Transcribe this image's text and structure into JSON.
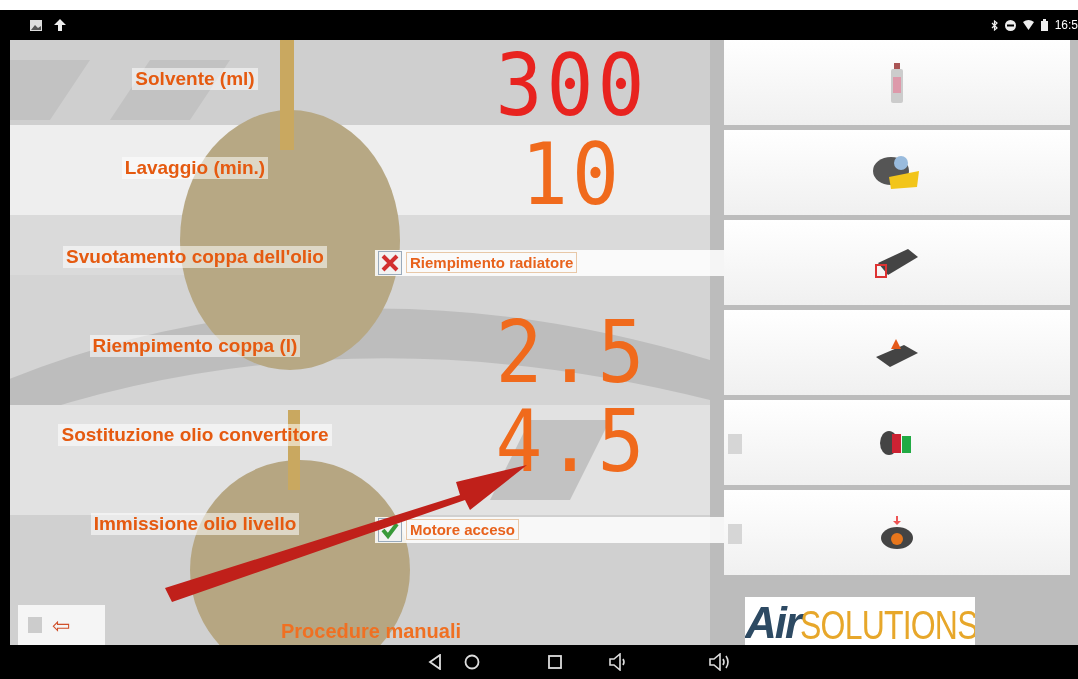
{
  "status_bar": {
    "time": "16:5"
  },
  "settings": [
    {
      "kind": "value",
      "label": "Solvente (ml)",
      "value": "300",
      "color": "#e8231f"
    },
    {
      "kind": "value",
      "label": "Lavaggio (min.)",
      "value": "10",
      "color": "#f06a1c"
    },
    {
      "kind": "option",
      "label": "Svuotamento coppa dell'olio",
      "option": {
        "label": "Riempimento radiatore",
        "kind": "cross"
      }
    },
    {
      "kind": "value",
      "label": "Riempimento coppa (l)",
      "value": "2.5",
      "color": "#f06a1c"
    },
    {
      "kind": "value",
      "label": "Sostituzione olio convertitore",
      "value": "4.5",
      "color": "#f06a1c"
    },
    {
      "kind": "option",
      "label": "Immissione olio livello",
      "option": {
        "label": "Motore acceso",
        "kind": "tick"
      }
    }
  ],
  "back_button": {
    "label": "⇦"
  },
  "title": "Procedure manuali",
  "tiles": [
    {
      "indicator": false
    },
    {
      "indicator": false
    },
    {
      "indicator": false
    },
    {
      "indicator": false
    },
    {
      "indicator": true
    },
    {
      "indicator": true
    }
  ],
  "logo": {
    "part_1": "Air",
    "part_2": "SOLUTIONS"
  }
}
